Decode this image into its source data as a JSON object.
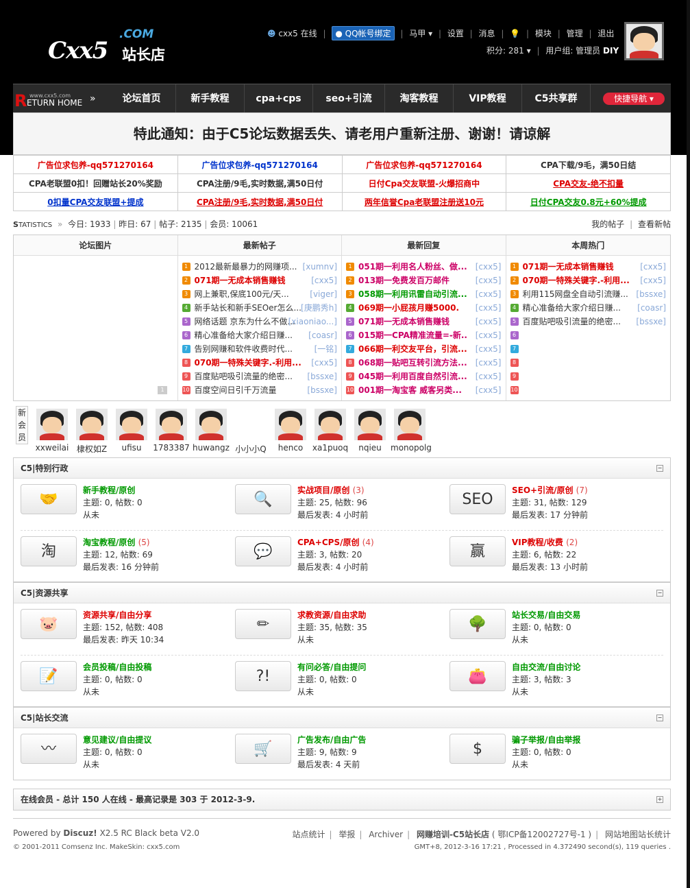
{
  "header": {
    "logo_main": "Cxx5",
    "logo_domain": ".COM",
    "logo_cn": "站长店",
    "user": "cxx5",
    "online": "在线",
    "qq_bind": "QQ帐号绑定",
    "majia": "马甲",
    "settings": "设置",
    "messages": "消息",
    "module": "模块",
    "manage": "管理",
    "logout": "退出",
    "points": "积分: 281",
    "usergroup": "用户组: 管理员",
    "diy": "DIY"
  },
  "nav": {
    "return_small": "www.cxx5.com",
    "return_r": "R",
    "return_home": "ETURN HOME",
    "return_arrow": "»",
    "items": [
      "论坛首页",
      "新手教程",
      "cpa+cps",
      "seo+引流",
      "淘客教程",
      "VIP教程",
      "C5共享群"
    ],
    "quick": "快捷导航"
  },
  "notice": "特此通知：由于C5论坛数据丢失、请老用户重新注册、谢谢！请谅解",
  "ads": [
    [
      {
        "t": "广告位求包养-qq571270164",
        "c": "red"
      },
      {
        "t": "广告位求包养-qq571270164",
        "c": "blue"
      },
      {
        "t": "广告位求包养-qq571270164",
        "c": "red"
      },
      {
        "t": "CPA下载/9毛，满50日结",
        "c": "dk"
      }
    ],
    [
      {
        "t": "CPA老联盟0扣！回赠站长20%奖励",
        "c": "dk"
      },
      {
        "t": "CPA注册/9毛,实时数据,满50日付",
        "c": "dk"
      },
      {
        "t": "日付Cpa交友联盟-火爆招商中",
        "c": "red"
      },
      {
        "t": "CPA交友-绝不扣量",
        "c": "red ul"
      }
    ],
    [
      {
        "t": "0扣量CPA交友联盟+提成",
        "c": "blue ul"
      },
      {
        "t": "CPA注册/9毛,实时数据,满50日付",
        "c": "red ul"
      },
      {
        "t": "两年信誉Cpa老联盟注册送10元",
        "c": "red ul"
      },
      {
        "t": "日付CPA交友0.8元+60%提成",
        "c": "grn ul"
      }
    ]
  ],
  "stats": {
    "label_s": "S",
    "label": "TATISTICS",
    "arrow": "»",
    "today": "今日: 1933",
    "yesterday": "昨日: 67",
    "posts": "帖子: 2135",
    "members": "会员: 10061",
    "my_posts": "我的帖子",
    "new_posts": "查看新帖"
  },
  "fourcol": {
    "headers": [
      "论坛图片",
      "最新帖子",
      "最新回复",
      "本周热门"
    ],
    "img_page": "1",
    "newest": [
      {
        "t": "2012最新最暴力的网赚项...",
        "a": "[xumnv]",
        "c": "dk"
      },
      {
        "t": "071期一无成本销售赚钱",
        "a": "[cxx5]",
        "c": "red"
      },
      {
        "t": "网上兼职,保底100元/天...",
        "a": "[viger]",
        "c": "dk"
      },
      {
        "t": "新手站长和新手SEOer怎么...",
        "a": "[庚鹏秀h]",
        "c": "dk"
      },
      {
        "t": "网络话题 京东为什么不做...",
        "a": "[xiaoniao...]",
        "c": "dk"
      },
      {
        "t": "精心准备给大家介绍日赚...",
        "a": "[coasr]",
        "c": "dk"
      },
      {
        "t": "告别网赚和软件收费时代...",
        "a": "[一铭]",
        "c": "dk"
      },
      {
        "t": "070期一特殊关键字.-利用...",
        "a": "[cxx5]",
        "c": "red"
      },
      {
        "t": "百度贴吧吸引流量的绝密...",
        "a": "[bssxe]",
        "c": "dk"
      },
      {
        "t": "百度空间日引千万流量",
        "a": "[bssxe]",
        "c": "dk"
      }
    ],
    "replies": [
      {
        "t": "051期一利用名人粉丝、做...",
        "a": "[cxx5]",
        "c": "mag"
      },
      {
        "t": "013期一免费发百万邮件",
        "a": "[cxx5]",
        "c": "mag"
      },
      {
        "t": "058期一利用讯雷自动引流...",
        "a": "[cxx5]",
        "c": "grn"
      },
      {
        "t": "069期一小屁孩月赚5000.",
        "a": "[cxx5]",
        "c": "red"
      },
      {
        "t": "071期一无成本销售赚钱",
        "a": "[cxx5]",
        "c": "mag"
      },
      {
        "t": "015期一CPA精准流量=-新...",
        "a": "[cxx5]",
        "c": "mag"
      },
      {
        "t": "066期一利交友平台，引流...",
        "a": "[cxx5]",
        "c": "red"
      },
      {
        "t": "068期一贴吧互转引流方法...",
        "a": "[cxx5]",
        "c": "mag"
      },
      {
        "t": "045期一利用百度自然引流...",
        "a": "[cxx5]",
        "c": "mag"
      },
      {
        "t": "001期一淘宝客 威客另类...",
        "a": "[cxx5]",
        "c": "mag"
      }
    ],
    "hot": [
      {
        "t": "071期一无成本销售赚钱",
        "a": "[cxx5]",
        "c": "red"
      },
      {
        "t": "070期一特殊关键字.-利用...",
        "a": "[cxx5]",
        "c": "red"
      },
      {
        "t": "利用115网盘全自动引流赚...",
        "a": "[bssxe]",
        "c": "dk"
      },
      {
        "t": "精心准备给大家介绍日赚...",
        "a": "[coasr]",
        "c": "dk"
      },
      {
        "t": "百度贴吧吸引流量的绝密...",
        "a": "[bssxe]",
        "c": "dk"
      },
      {
        "t": "",
        "a": "",
        "c": "dk"
      },
      {
        "t": "",
        "a": "",
        "c": "dk"
      },
      {
        "t": "",
        "a": "",
        "c": "dk"
      },
      {
        "t": "",
        "a": "",
        "c": "dk"
      },
      {
        "t": "",
        "a": "",
        "c": "dk"
      }
    ]
  },
  "members": {
    "label": "新会员",
    "list": [
      "xxweilai",
      "棣权如Z",
      "ufisu",
      "1783387",
      "huwangz",
      "小小小Q",
      "henco",
      "xa1puoq",
      "nqieu",
      "monopolg"
    ]
  },
  "sections": [
    {
      "title": "C5|特别行政",
      "rows": [
        [
          {
            "name": "新手教程/原创",
            "count": "",
            "l2": "主题: 0, 帖数: 0",
            "l3": "从未",
            "icon": "handshake-icon",
            "glyph": "🤝",
            "color": "#009900"
          },
          {
            "name": "实战项目/原创",
            "count": "(3)",
            "l2": "主题: 25, 帖数: 96",
            "l3": "最后发表: 4 小时前",
            "icon": "magnifier-icon",
            "glyph": "🔍",
            "color": "#d00"
          },
          {
            "name": "SEO+引流/原创",
            "count": "(7)",
            "l2": "主题: 31, 帖数: 129",
            "l3": "最后发表: 17 分钟前",
            "icon": "seo-icon",
            "glyph": "SEO",
            "color": "#d00"
          }
        ],
        [
          {
            "name": "淘宝教程/原创",
            "count": "(5)",
            "l2": "主题: 12, 帖数: 69",
            "l3": "最后发表: 16 分钟前",
            "icon": "taobao-icon",
            "glyph": "淘",
            "color": "#009900"
          },
          {
            "name": "CPA+CPS/原创",
            "count": "(4)",
            "l2": "主题: 3, 帖数: 20",
            "l3": "最后发表: 4 小时前",
            "icon": "chat-bubbles-icon",
            "glyph": "💬",
            "color": "#d00"
          },
          {
            "name": "VIP教程/收费",
            "count": "(2)",
            "l2": "主题: 6, 帖数: 22",
            "l3": "最后发表: 13 小时前",
            "icon": "win-icon",
            "glyph": "赢",
            "color": "#d00"
          }
        ]
      ]
    },
    {
      "title": "C5|资源共享",
      "rows": [
        [
          {
            "name": "资源共享/自由分享",
            "count": "",
            "l2": "主题: 152, 帖数: 408",
            "l3": "最后发表: 昨天 10:34",
            "icon": "piggy-bank-icon",
            "glyph": "🐷",
            "color": "#d00"
          },
          {
            "name": "求教资源/自由求助",
            "count": "",
            "l2": "主题: 35, 帖数: 35",
            "l3": "从未",
            "icon": "help-user-icon",
            "glyph": "✏",
            "color": "#d00"
          },
          {
            "name": "站长交易/自由交易",
            "count": "",
            "l2": "主题: 0, 帖数: 0",
            "l3": "从未",
            "icon": "money-tree-icon",
            "glyph": "🌳",
            "color": "#009900"
          }
        ],
        [
          {
            "name": "会员投稿/自由投稿",
            "count": "",
            "l2": "主题: 0, 帖数: 0",
            "l3": "从未",
            "icon": "document-edit-icon",
            "glyph": "📝",
            "color": "#009900"
          },
          {
            "name": "有问必答/自由提问",
            "count": "",
            "l2": "主题: 0, 帖数: 0",
            "l3": "从未",
            "icon": "question-warning-icon",
            "glyph": "?!",
            "color": "#009900"
          },
          {
            "name": "自由交流/自由讨论",
            "count": "",
            "l2": "主题: 3, 帖数: 3",
            "l3": "从未",
            "icon": "wallet-icon",
            "glyph": "👛",
            "color": "#009900"
          }
        ]
      ]
    },
    {
      "title": "C5|站长交流",
      "rows": [
        [
          {
            "name": "意见建议/自由提议",
            "count": "",
            "l2": "主题: 0, 帖数: 0",
            "l3": "从未",
            "icon": "pulse-globe-icon",
            "glyph": "〰",
            "color": "#009900"
          },
          {
            "name": "广告发布/自由广告",
            "count": "",
            "l2": "主题: 9, 帖数: 9",
            "l3": "最后发表: 4 天前",
            "icon": "shopping-cart-icon",
            "glyph": "🛒",
            "color": "#009900"
          },
          {
            "name": "骗子举报/自由举报",
            "count": "",
            "l2": "主题: 0, 帖数: 0",
            "l3": "从未",
            "icon": "money-bag-icon",
            "glyph": "$",
            "color": "#009900"
          }
        ]
      ]
    }
  ],
  "online": "在线会员 - 总计 150 人在线 - 最高记录是 303 于 2012-3-9.",
  "footer": {
    "powered_pre": "Powered by",
    "powered_name": "Discuz!",
    "powered_ver": "X2.5 RC Black beta V2.0",
    "copyright": "© 2001-2011 Comsenz Inc. MakeSkin: cxx5.com",
    "links": [
      "站点统计",
      "举报",
      "Archiver",
      "网赚培训-C5站长店",
      "( 鄂ICP备12002727号-1 )",
      "网站地图站长统计"
    ],
    "debug": "GMT+8, 2012-3-16 17:21 , Processed in 4.372490 second(s), 119 queries ."
  },
  "colors": {
    "red": "#dd0000",
    "blue": "#0033cc",
    "green": "#009900",
    "magenta": "#cc0066",
    "nav_bg": "#2a2a2a",
    "quick_bg": "#e0263a"
  }
}
